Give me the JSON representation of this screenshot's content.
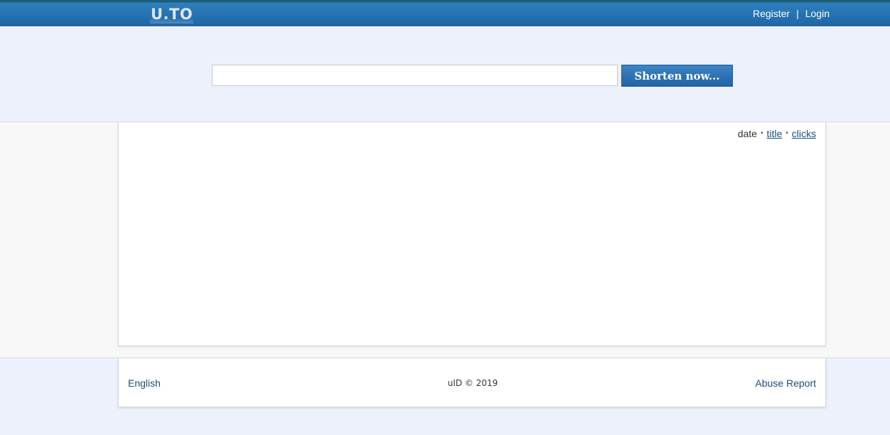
{
  "header": {
    "logo_text": "U.TO",
    "register_label": "Register",
    "separator": "|",
    "login_label": "Login"
  },
  "shortener": {
    "input_value": "",
    "input_placeholder": "",
    "button_label": "Shorten now..."
  },
  "sort": {
    "date_label": "date",
    "dot": "•",
    "title_label": "title",
    "clicks_label": "clicks"
  },
  "footer": {
    "language_label": "English",
    "copyright": "uID © 2019",
    "abuse_label": "Abuse Report"
  }
}
